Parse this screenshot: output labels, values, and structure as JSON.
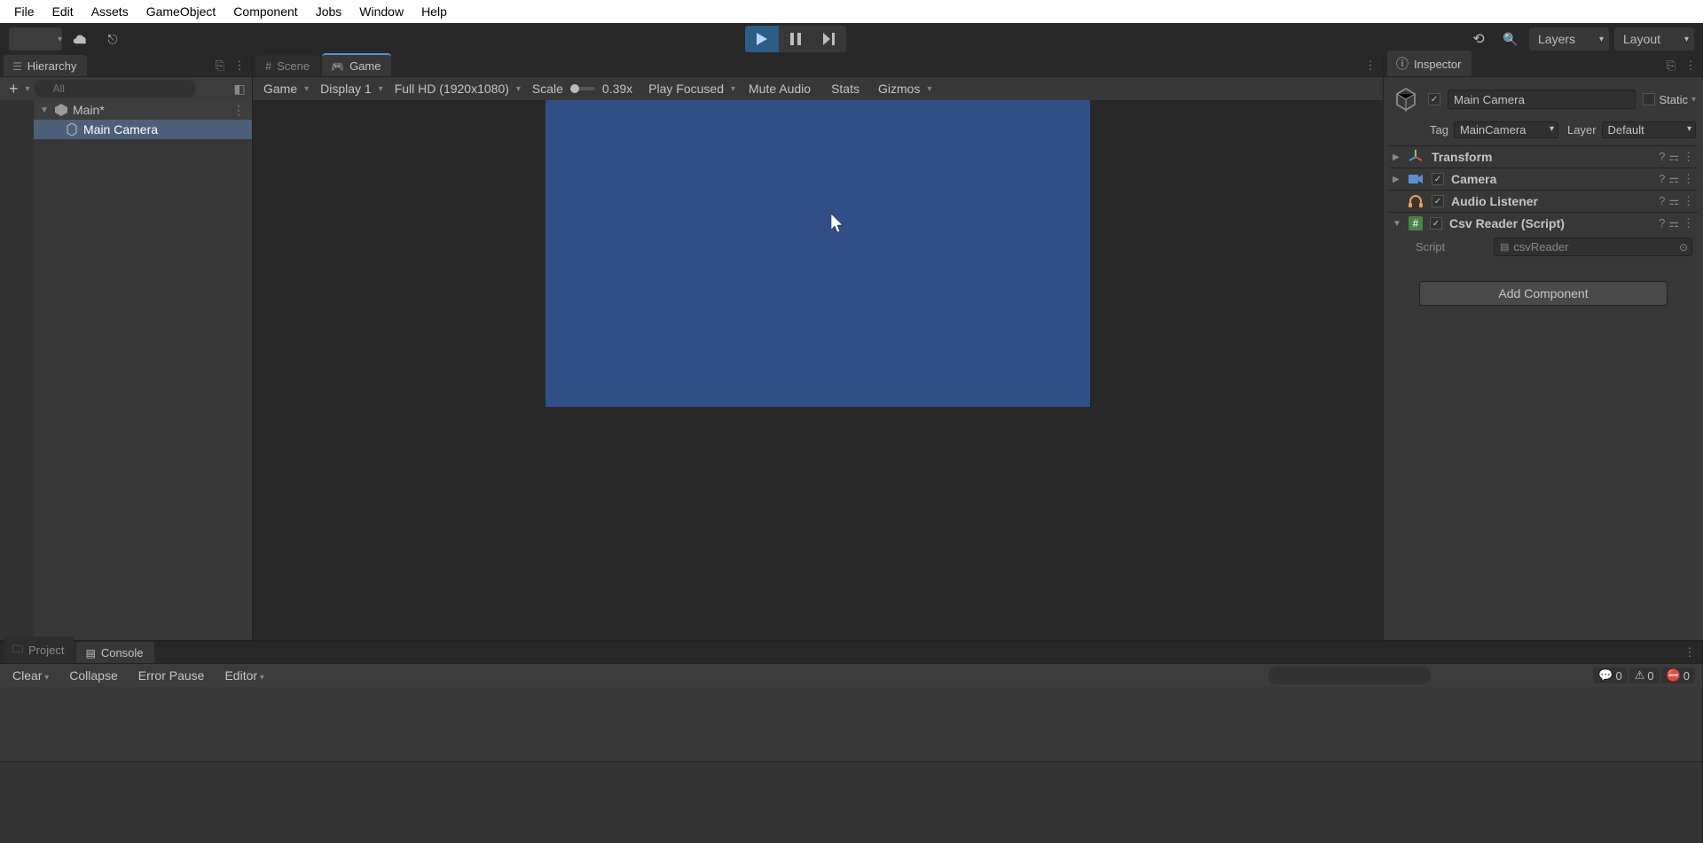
{
  "menu": [
    "File",
    "Edit",
    "Assets",
    "GameObject",
    "Component",
    "Jobs",
    "Window",
    "Help"
  ],
  "toolbar": {
    "layers_label": "Layers",
    "layout_label": "Layout"
  },
  "hierarchy": {
    "title": "Hierarchy",
    "search_placeholder": "All",
    "scene": "Main*",
    "items": [
      "Main Camera"
    ]
  },
  "game_view": {
    "tab_scene": "Scene",
    "tab_game": "Game",
    "view_dd": "Game",
    "display_dd": "Display 1",
    "resolution_dd": "Full HD (1920x1080)",
    "scale_label": "Scale",
    "scale_value": "0.39x",
    "focus_dd": "Play Focused",
    "mute": "Mute Audio",
    "stats": "Stats",
    "gizmos": "Gizmos"
  },
  "inspector": {
    "title": "Inspector",
    "object_name": "Main Camera",
    "static_label": "Static",
    "tag_label": "Tag",
    "tag_value": "MainCamera",
    "layer_label": "Layer",
    "layer_value": "Default",
    "components": [
      {
        "name": "Transform",
        "icon": "axes",
        "expanded": false,
        "check": false
      },
      {
        "name": "Camera",
        "icon": "camera",
        "expanded": false,
        "check": true
      },
      {
        "name": "Audio Listener",
        "icon": "headphones",
        "expanded": false,
        "check": true
      },
      {
        "name": "Csv Reader (Script)",
        "icon": "script",
        "expanded": true,
        "check": true
      }
    ],
    "script": {
      "label": "Script",
      "value": "csvReader"
    },
    "add_component": "Add Component"
  },
  "console": {
    "tab_project": "Project",
    "tab_console": "Console",
    "clear": "Clear",
    "collapse": "Collapse",
    "error_pause": "Error Pause",
    "editor": "Editor",
    "counts": {
      "info": "0",
      "warn": "0",
      "error": "0"
    }
  }
}
